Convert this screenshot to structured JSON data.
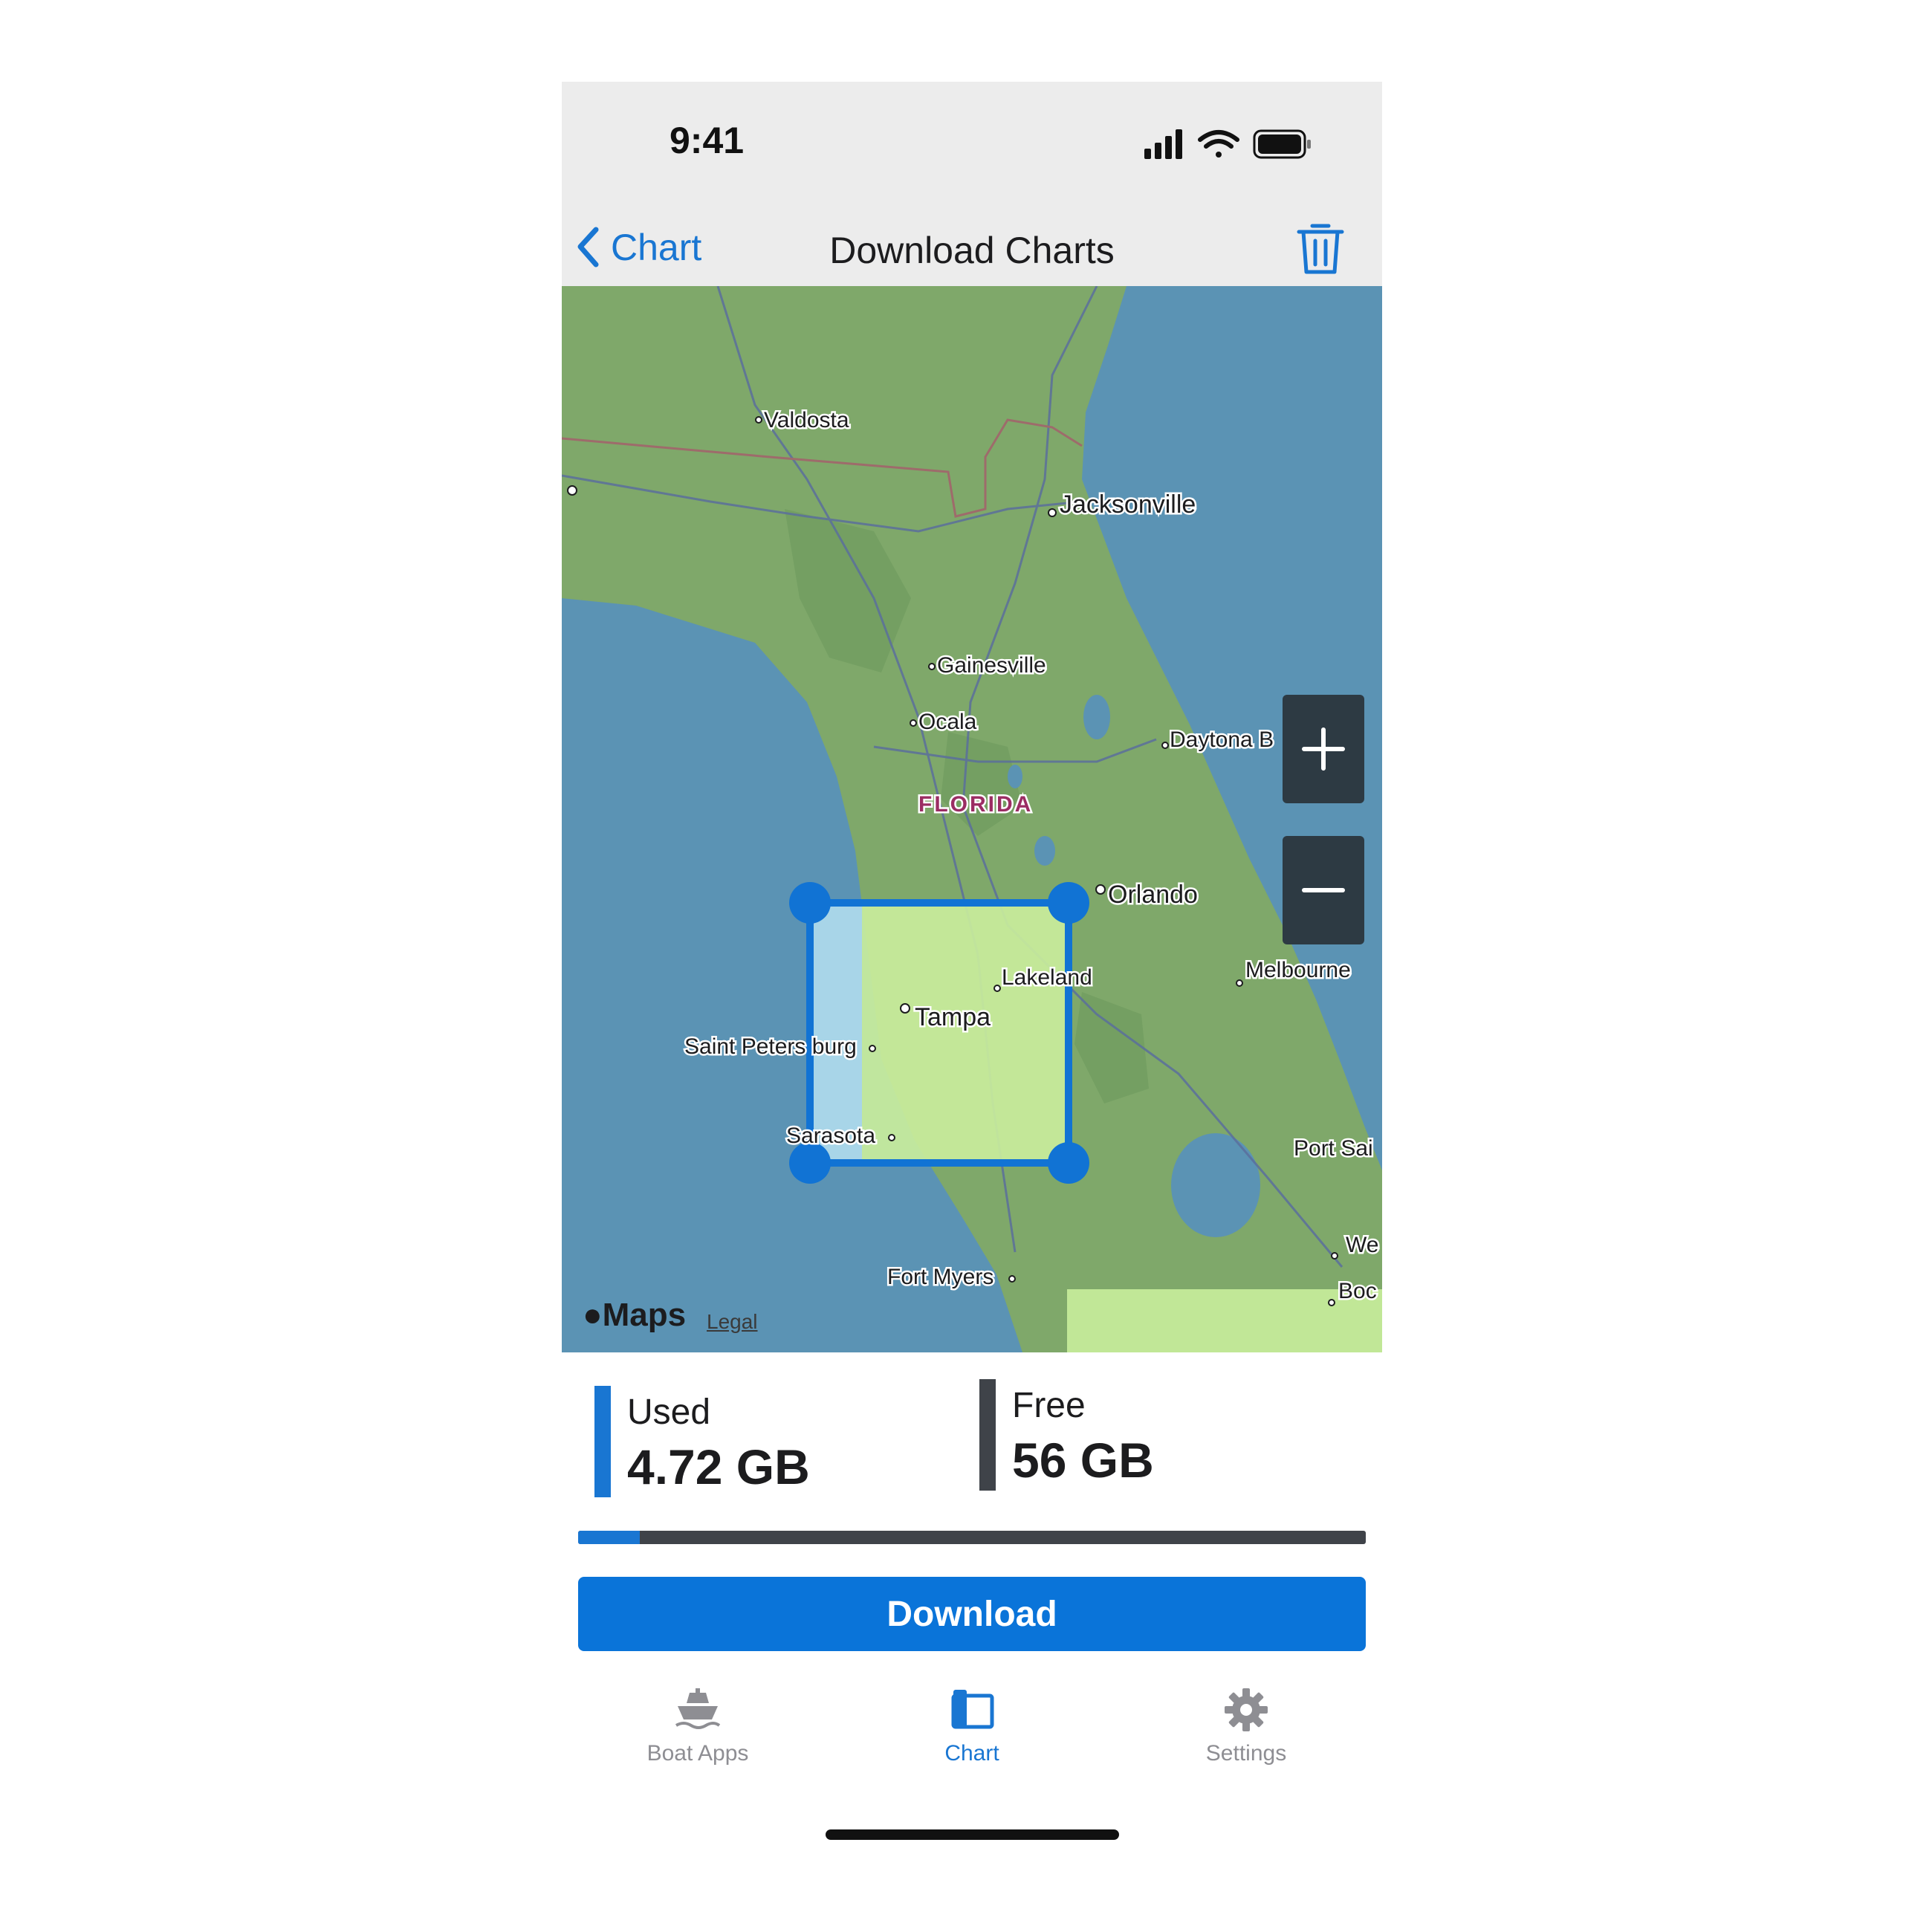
{
  "status_bar": {
    "time": "9:41"
  },
  "nav": {
    "back_label": "Chart",
    "title": "Download Charts"
  },
  "map": {
    "region_label": "FLORIDA",
    "cities": [
      "Valdosta",
      "Jacksonville",
      "Gainesville",
      "Ocala",
      "Daytona B",
      "Orlando",
      "Melbourne",
      "Lakeland",
      "Tampa",
      "Saint Peters burg",
      "Sarasota",
      "Port Sai",
      "We",
      "Fort Myers",
      "Boc"
    ],
    "attribution_logo": "Maps",
    "legal": "Legal",
    "zoom_in": "+",
    "zoom_out": "−"
  },
  "storage": {
    "used_label": "Used",
    "used_value": "4.72 GB",
    "free_label": "Free",
    "free_value": "56 GB",
    "used_fraction": 0.078
  },
  "download_label": "Download",
  "tabs": [
    {
      "label": "Boat Apps",
      "icon": "boat-icon",
      "active": false
    },
    {
      "label": "Chart",
      "icon": "chart-icon",
      "active": true
    },
    {
      "label": "Settings",
      "icon": "gear-icon",
      "active": false
    }
  ],
  "colors": {
    "accent": "#1976d2",
    "button": "#0a74d9",
    "tab_inactive": "#8e8e93",
    "water": "#5b93b4",
    "land": "#7fa86a"
  }
}
